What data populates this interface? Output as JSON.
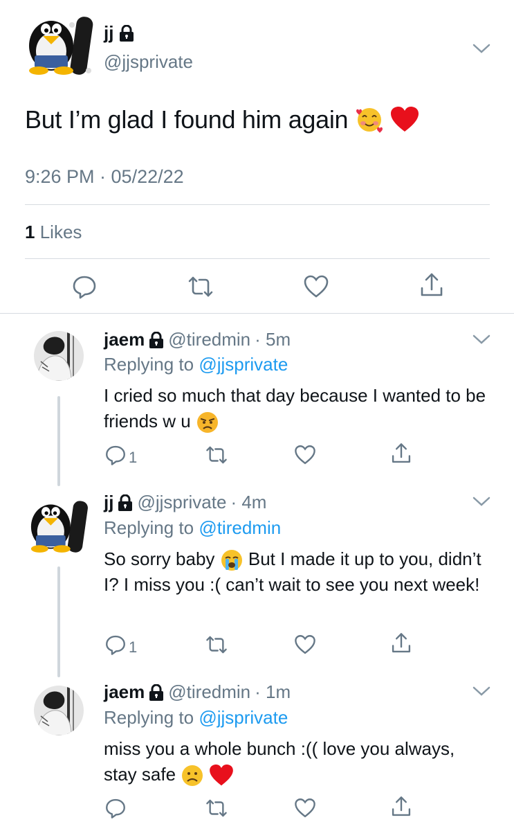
{
  "main_tweet": {
    "display_name": "jj",
    "handle": "@jjsprivate",
    "text": "But I’m glad I found him again",
    "timestamp": "9:26 PM · 05/22/22",
    "likes_count": "1",
    "likes_label": "Likes"
  },
  "replies": [
    {
      "display_name": "jaem",
      "handle": "@tiredmin",
      "time": "· 5m",
      "replying_prefix": "Replying to",
      "replying_to": "@jjsprivate",
      "text": "I cried so much that day because I wanted to be friends w u",
      "reply_count": "1"
    },
    {
      "display_name": "jj",
      "handle": "@jjsprivate",
      "time": "· 4m",
      "replying_prefix": "Replying to",
      "replying_to": "@tiredmin",
      "text_before_emoji": "So sorry baby",
      "text_after_emoji": "But I made it up to you, didn’t I? I miss you :( can’t wait to see you next week!",
      "reply_count": "1"
    },
    {
      "display_name": "jaem",
      "handle": "@tiredmin",
      "time": "· 1m",
      "replying_prefix": "Replying to",
      "replying_to": "@jjsprivate",
      "text": "miss you a whole bunch :(( love you always, stay safe",
      "reply_count": ""
    }
  ],
  "colors": {
    "link": "#1d9bf0",
    "secondary": "#657786",
    "divider": "#d6dbe0"
  }
}
